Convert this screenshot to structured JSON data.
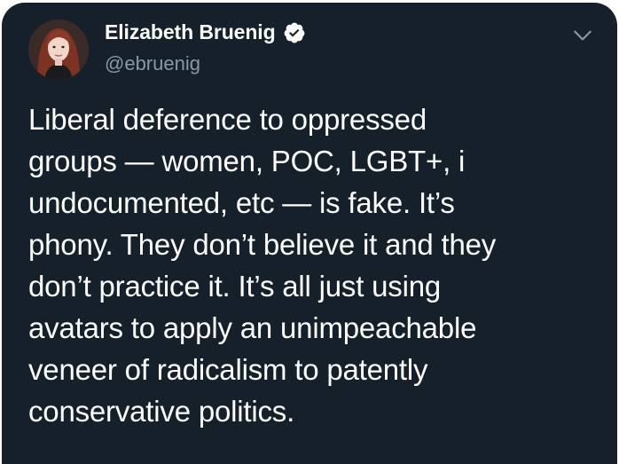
{
  "tweet": {
    "display_name": "Elizabeth Bruenig",
    "handle": "@ebruenig",
    "verified": true,
    "text_lines": [
      "Liberal deference to oppressed",
      "groups — women, POC, LGBT+, i",
      "undocumented, etc — is fake. It’s",
      "phony. They don’t believe it and they",
      "don’t practice it. It’s all just using",
      "avatars to apply an unimpeachable",
      "veneer of radicalism to patently",
      "conservative politics."
    ]
  },
  "icons": {
    "verified": "verified-badge-icon",
    "more": "chevron-down-icon"
  },
  "colors": {
    "background": "#15202b",
    "text": "#ffffff",
    "secondary_text": "#8899a6"
  }
}
